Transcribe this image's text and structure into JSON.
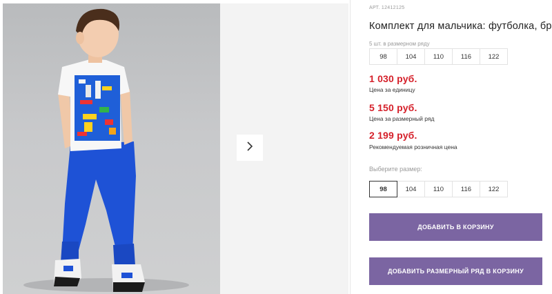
{
  "product": {
    "article": "АРТ. 12412125",
    "title": "Комплект для мальчика: футболка, брюки"
  },
  "size_range": {
    "label": "5 шт. в размерном ряду",
    "sizes": [
      "98",
      "104",
      "110",
      "116",
      "122"
    ]
  },
  "prices": [
    {
      "value": "1 030 руб.",
      "note": "Цена за единицу"
    },
    {
      "value": "5 150 руб.",
      "note": "Цена за размерный ряд"
    },
    {
      "value": "2 199 руб.",
      "note": "Рекомендуемая розничная цена"
    }
  ],
  "size_picker": {
    "label": "Выберите размер:",
    "sizes": [
      "98",
      "104",
      "110",
      "116",
      "122"
    ],
    "selected": "98"
  },
  "buttons": {
    "add_to_cart": "ДОБАВИТЬ В КОРЗИНУ",
    "add_range_to_cart": "ДОБАВИТЬ РАЗМЕРНЫЙ РЯД В КОРЗИНУ"
  },
  "gallery": {
    "next_icon": "chevron-right-icon"
  },
  "colors": {
    "price": "#d5202a",
    "button": "#7b65a2"
  }
}
